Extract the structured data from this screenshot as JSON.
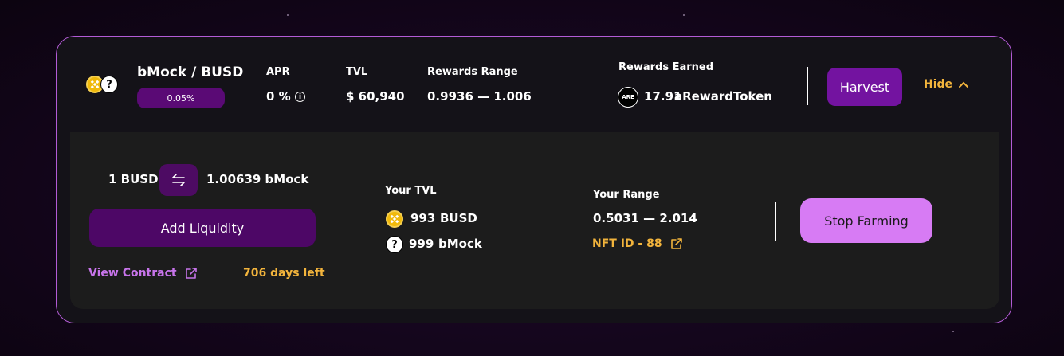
{
  "farm": {
    "pair_name": "bMock / BUSD",
    "fee_tier": "0.05%",
    "apr_label": "APR",
    "apr_value": "0 %",
    "tvl_label": "TVL",
    "tvl_value": "$ 60,940",
    "rewards_range_label": "Rewards Range",
    "rewards_range_value": "0.9936 — 1.006",
    "rewards_earned_label": "Rewards Earned",
    "reward_badge": "ARE",
    "reward_amount": "17.91",
    "reward_token": "aRewardToken",
    "harvest_label": "Harvest",
    "hide_label": "Hide"
  },
  "details": {
    "rate_left": "1 BUSD",
    "rate_right": "1.00639 bMock",
    "add_liquidity_label": "Add Liquidity",
    "view_contract_label": "View Contract",
    "days_left": "706 days left",
    "your_tvl_label": "Your TVL",
    "tvl_busd_amount": "993",
    "tvl_busd_symbol": "BUSD",
    "tvl_bmock_amount": "999",
    "tvl_bmock_symbol": "bMock",
    "your_range_label": "Your Range",
    "your_range_value": "0.5031 — 2.014",
    "nft_id_label": "NFT ID - 88",
    "stop_farming_label": "Stop Farming"
  },
  "icons": {
    "busd": "busd-token-icon",
    "bmock": "unknown-token-icon",
    "info": "info-icon",
    "swap": "swap-arrows-icon",
    "external": "external-link-icon",
    "chevron": "chevron-up-icon"
  },
  "colors": {
    "accent_purple": "#7313a0",
    "stop_button": "#d77bf4",
    "gold": "#f2b43c",
    "link_purple": "#c774ea",
    "card_border": "#b35bd6"
  }
}
